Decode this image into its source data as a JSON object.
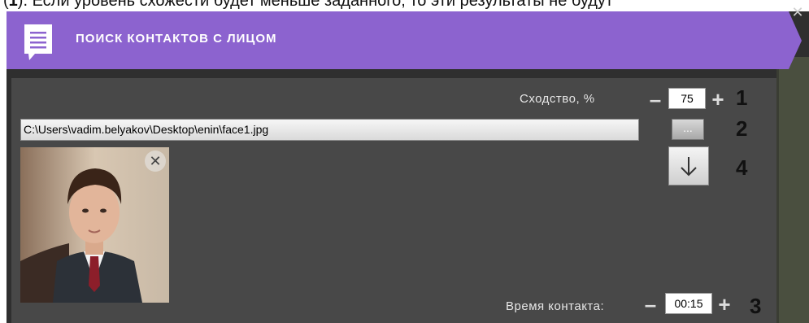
{
  "doc_text": {
    "prefix": "(",
    "bold": "1",
    "rest": "). Если уровень схожести будет меньше заданного, то эти результаты не будут"
  },
  "window": {
    "close_glyph": "✕"
  },
  "header": {
    "title": "ПОИСК КОНТАКТОВ С ЛИЦОМ"
  },
  "controls": {
    "similarity": {
      "label": "Сходство, %",
      "value": "75",
      "minus": "–",
      "plus": "+"
    },
    "file": {
      "path": "C:\\Users\\vadim.belyakov\\Desktop\\enin\\face1.jpg",
      "browse_label": "..."
    },
    "duration": {
      "label": "Время контакта:",
      "value": "00:15",
      "minus": "–",
      "plus": "+"
    },
    "photo_close": "✕"
  },
  "callouts": {
    "n1": "1",
    "n2": "2",
    "n3": "3",
    "n4": "4"
  },
  "colors": {
    "header_bg": "#8c63cf",
    "panel_bg": "#484848",
    "frame_bg": "#2f2f2f"
  },
  "icons": {
    "header": "chat-bubble-icon",
    "download": "arrow-down-icon",
    "photo_remove": "close-icon"
  }
}
